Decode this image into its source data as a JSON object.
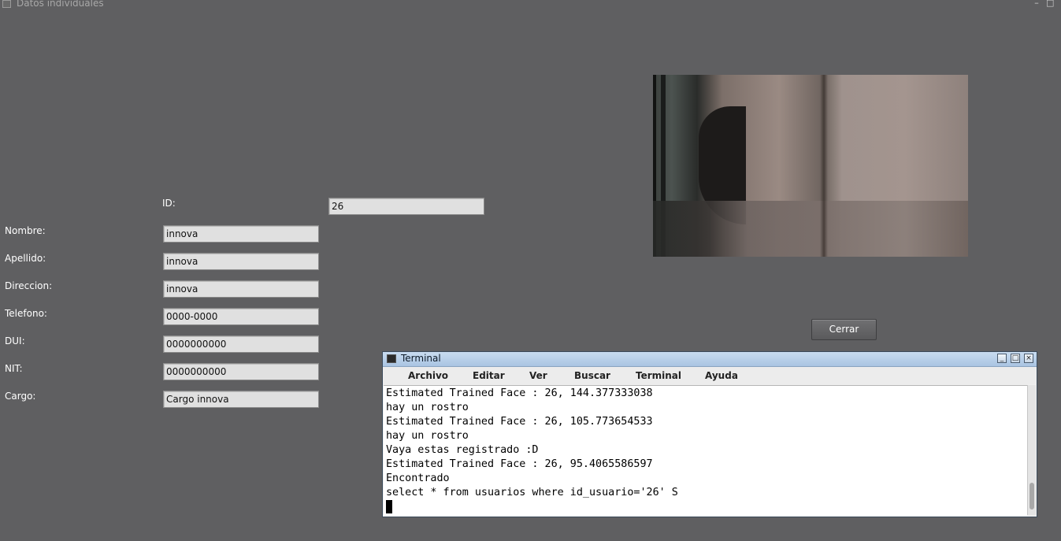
{
  "window": {
    "title": "Datos individuales",
    "minimize_glyph": "–",
    "maximize_glyph": "□"
  },
  "form": {
    "id": {
      "label": "ID:",
      "value": "26"
    },
    "nombre": {
      "label": "Nombre:",
      "value": "innova"
    },
    "apellido": {
      "label": "Apellido:",
      "value": "innova"
    },
    "direccion": {
      "label": "Direccion:",
      "value": "innova"
    },
    "telefono": {
      "label": "Telefono:",
      "value": "0000-0000"
    },
    "dui": {
      "label": "DUI:",
      "value": "0000000000"
    },
    "nit": {
      "label": "NIT:",
      "value": "0000000000"
    },
    "cargo": {
      "label": "Cargo:",
      "value": "Cargo innova"
    }
  },
  "close_button": "Cerrar",
  "terminal": {
    "title": "Terminal",
    "menu": [
      "Archivo",
      "Editar",
      "Ver",
      "Buscar",
      "Terminal",
      "Ayuda"
    ],
    "lines": [
      "Estimated Trained Face : 26, 144.377333038",
      "hay un rostro",
      "Estimated Trained Face : 26, 105.773654533",
      "hay un rostro",
      "Vaya estas registrado :D",
      "Estimated Trained Face : 26, 95.4065586597",
      "Encontrado",
      "select * from usuarios where id_usuario='26' S"
    ]
  },
  "colors": {
    "background": "#5f5f61",
    "field_bg": "#e0e0e0",
    "terminal_title": "#b9d0ea"
  }
}
